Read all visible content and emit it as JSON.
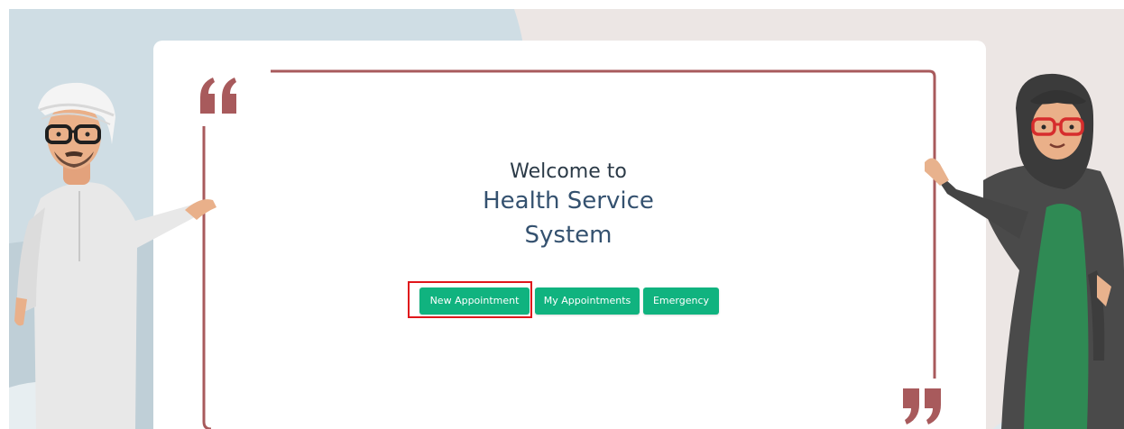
{
  "welcome": {
    "line1": "Welcome to",
    "line2": "Health Service",
    "line3": "System"
  },
  "actions": {
    "new_appointment": "New Appointment",
    "my_appointments": "My Appointments",
    "emergency": "Emergency"
  },
  "colors": {
    "accent_button": "#10b37f",
    "frame": "#a85a5c",
    "highlight": "#e0161b",
    "heading": "#34516f"
  }
}
